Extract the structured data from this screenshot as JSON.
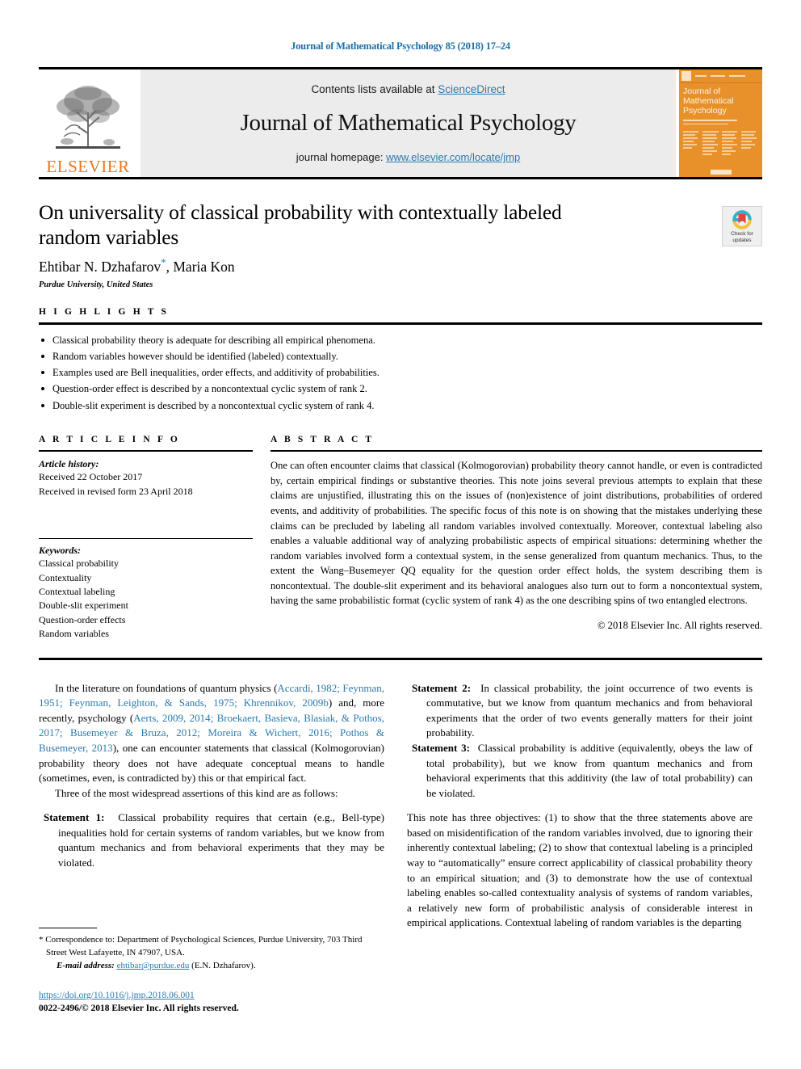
{
  "running_head": "Journal of Mathematical Psychology 85 (2018) 17–24",
  "masthead": {
    "publisher_wordmark": "ELSEVIER",
    "contents_prefix": "Contents lists available at ",
    "contents_link": "ScienceDirect",
    "journal_name": "Journal of Mathematical Psychology",
    "homepage_prefix": "journal homepage: ",
    "homepage_link": "www.elsevier.com/locate/jmp",
    "cover_title_line1": "Journal of",
    "cover_title_line2": "Mathematical",
    "cover_title_line3": "Psychology"
  },
  "crossmark": {
    "line1": "Check for",
    "line2": "updates"
  },
  "article": {
    "title": "On universality of classical probability with contextually labeled random variables",
    "authors": "Ehtibar N. Dzhafarov",
    "authors_tail": ", Maria Kon",
    "corresponding_marker": "*",
    "affiliation": "Purdue University, United States"
  },
  "highlights": {
    "label": "H I G H L I G H T S",
    "items": [
      "Classical probability theory is adequate for describing all empirical phenomena.",
      "Random variables however should be identified (labeled) contextually.",
      "Examples used are Bell inequalities, order effects, and additivity of probabilities.",
      "Question-order effect is described by a noncontextual cyclic system of rank 2.",
      "Double-slit experiment is described by a noncontextual cyclic system of rank 4."
    ]
  },
  "article_info": {
    "label": "A R T I C L E    I N F O",
    "history_heading": "Article history:",
    "history": [
      "Received 22 October 2017",
      "Received in revised form 23 April 2018"
    ],
    "keywords_heading": "Keywords:",
    "keywords": [
      "Classical probability",
      "Contextuality",
      "Contextual labeling",
      "Double-slit experiment",
      "Question-order effects",
      "Random variables"
    ]
  },
  "abstract": {
    "label": "A B S T R A C T",
    "text": "One can often encounter claims that classical (Kolmogorovian) probability theory cannot handle, or even is contradicted by, certain empirical findings or substantive theories. This note joins several previous attempts to explain that these claims are unjustified, illustrating this on the issues of (non)existence of joint distributions, probabilities of ordered events, and additivity of probabilities. The specific focus of this note is on showing that the mistakes underlying these claims can be precluded by labeling all random variables involved contextually. Moreover, contextual labeling also enables a valuable additional way of analyzing probabilistic aspects of empirical situations: determining whether the random variables involved form a contextual system, in the sense generalized from quantum mechanics. Thus, to the extent the Wang–Busemeyer QQ equality for the question order effect holds, the system describing them is noncontextual. The double-slit experiment and its behavioral analogues also turn out to form a noncontextual system, having the same probabilistic format (cyclic system of rank 4) as the one describing spins of two entangled electrons.",
    "copyright": "© 2018 Elsevier Inc. All rights reserved."
  },
  "body": {
    "left": {
      "para1_lead": "In the literature on foundations of quantum physics (",
      "para1_cites_a": "Accardi, 1982; Feynman, 1951; Feynman, Leighton, & Sands, 1975; Khrennikov, 2009b",
      "para1_mid": ") and, more recently, psychology (",
      "para1_cites_b": "Aerts, 2009, 2014; Broekaert, Basieva, Blasiak, & Pothos, 2017; Busemeyer & Bruza, 2012; Moreira & Wichert, 2016; Pothos & Busemeyer, 2013",
      "para1_tail": "), one can encounter statements that classical (Kolmogorovian) probability theory does not have adequate conceptual means to handle (sometimes, even, is contradicted by) this or that empirical fact.",
      "para2": "Three of the most widespread assertions of this kind are as follows:",
      "statement1_label": "Statement 1:",
      "statement1_text": "Classical probability requires that certain (e.g., Bell-type) inequalities hold for certain systems of random variables, but we know from quantum mechanics and from behavioral experiments that they may be violated."
    },
    "right": {
      "statement2_label": "Statement 2:",
      "statement2_text": "In classical probability, the joint occurrence of two events is commutative, but we know from quantum mechanics and from behavioral experiments that the order of two events generally matters for their joint probability.",
      "statement3_label": "Statement 3:",
      "statement3_text": "Classical probability is additive (equivalently, obeys the law of total probability), but we know from quantum mechanics and from behavioral experiments that this additivity (the law of total probability) can be violated.",
      "para_objectives": "This note has three objectives: (1) to show that the three statements above are based on misidentification of the random variables involved, due to ignoring their inherently contextual labeling; (2) to show that contextual labeling is a principled way to “automatically” ensure correct applicability of classical probability theory to an empirical situation; and (3) to demonstrate how the use of contextual labeling enables so-called contextuality analysis of systems of random variables, a relatively new form of probabilistic analysis of considerable interest in empirical applications. Contextual labeling of random variables is the departing"
    }
  },
  "footnote": {
    "marker": "*",
    "text": " Correspondence to: Department of Psychological Sciences, Purdue University, 703 Third Street West Lafayette, IN 47907, USA.",
    "email_label": "E-mail address:",
    "email": "ehtibar@purdue.edu",
    "email_suffix": " (E.N. Dzhafarov)."
  },
  "footer": {
    "doi": "https://doi.org/10.1016/j.jmp.2018.06.001",
    "issn": "0022-2496/© 2018 Elsevier Inc. All rights reserved."
  },
  "colors": {
    "link_blue": "#2a7ab0",
    "elsevier_orange": "#E87722",
    "cover_orange": "#E8912B",
    "band_grey": "#ececec"
  }
}
